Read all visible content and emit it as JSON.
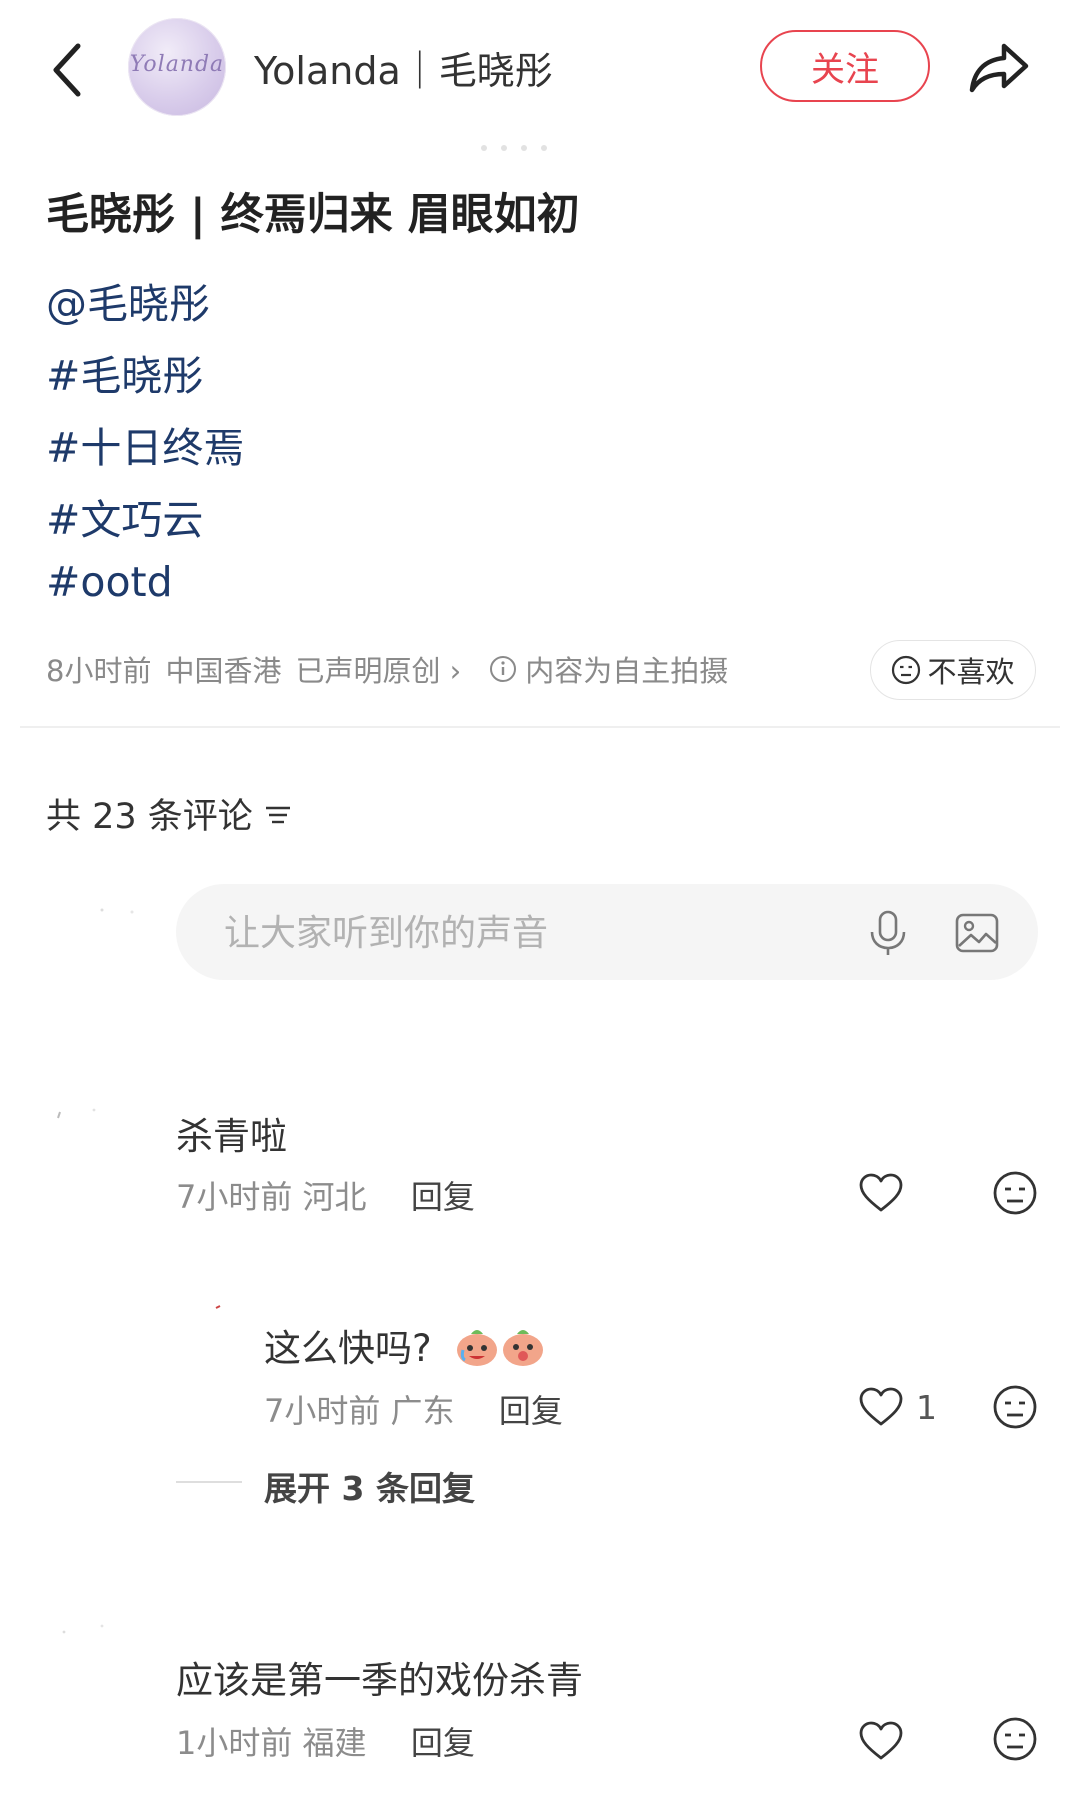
{
  "header": {
    "username": "Yolanda｜毛晓彤",
    "avatar_text": "Yolanda",
    "follow_label": "关注"
  },
  "post": {
    "title": "毛晓彤 | 终焉归来 眉眼如初",
    "tags": [
      "@毛晓彤",
      "#毛晓彤",
      "#十日终焉",
      "#文巧云",
      "#ootd"
    ],
    "meta_time": "8小时前",
    "meta_location": "中国香港",
    "meta_original": "已声明原创 ›",
    "meta_info": "内容为自主拍摄",
    "dislike_label": "不喜欢"
  },
  "comments_header": {
    "count_label": "共 23 条评论"
  },
  "comment_input": {
    "placeholder": "让大家听到你的声音"
  },
  "comments": [
    {
      "text": "杀青啦",
      "time": "7小时前",
      "location": "河北",
      "reply_label": "回复",
      "likes": ""
    },
    {
      "text": "这么快吗?",
      "time": "7小时前",
      "location": "广东",
      "reply_label": "回复",
      "likes": "1"
    },
    {
      "text": "应该是第一季的戏份杀青",
      "time": "1小时前",
      "location": "福建",
      "reply_label": "回复",
      "likes": ""
    }
  ],
  "expand_replies_label": "展开 3 条回复",
  "colors": {
    "accent_red": "#e8444f",
    "tag_blue": "#1e3a6a",
    "meta_gray": "#8a8a8a"
  },
  "icons": [
    "back-icon",
    "share-icon",
    "info-icon",
    "sort-icon",
    "mic-icon",
    "image-icon",
    "heart-icon",
    "dislike-face-icon",
    "emoji-sticker-icon"
  ]
}
